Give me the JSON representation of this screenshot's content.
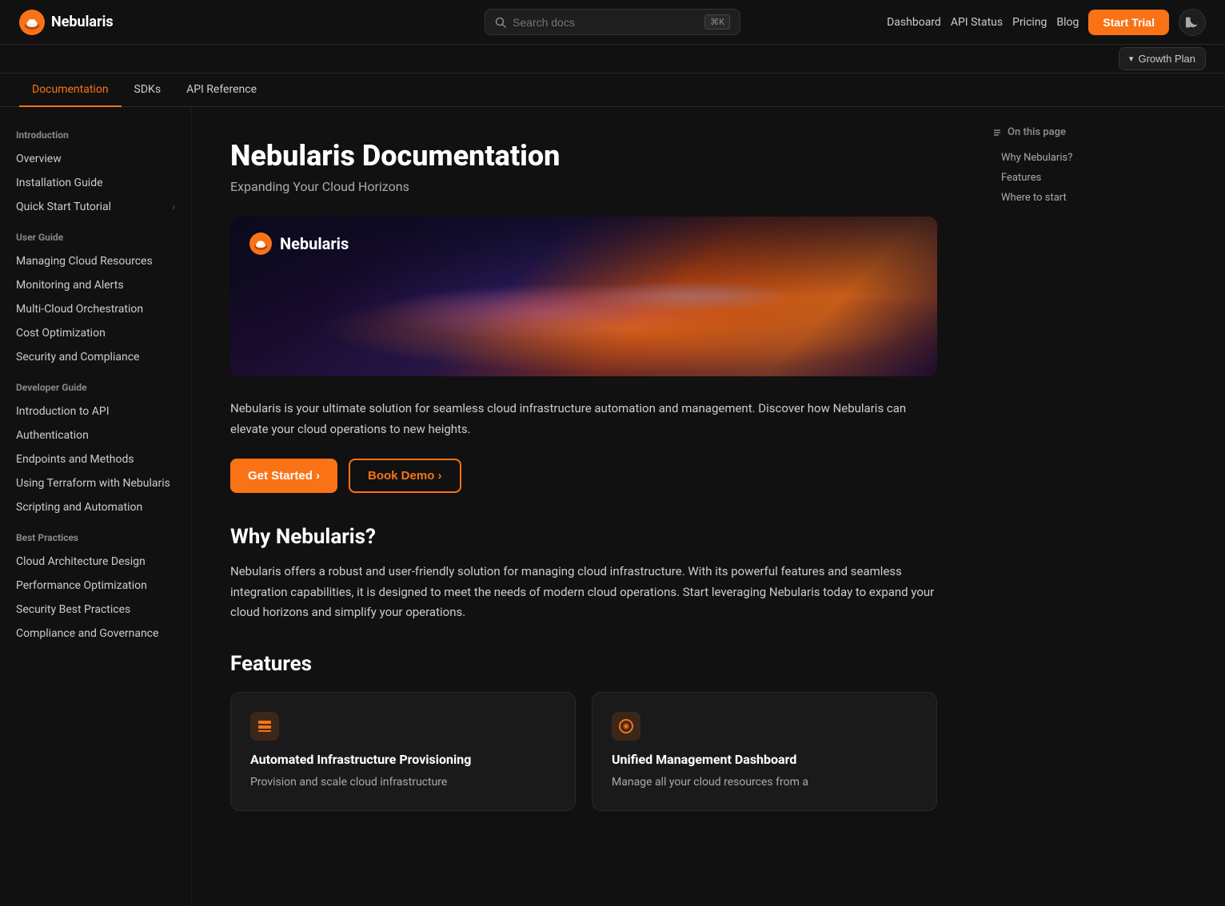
{
  "brand": {
    "name": "Nebularis",
    "logo_alt": "Nebularis logo"
  },
  "topbar": {
    "search_placeholder": "Search docs",
    "search_kbd": "⌘K",
    "nav_links": [
      {
        "label": "Dashboard"
      },
      {
        "label": "API Status"
      },
      {
        "label": "Pricing"
      },
      {
        "label": "Blog"
      }
    ],
    "trial_button": "Start Trial",
    "growth_plan_label": "Growth Plan"
  },
  "subnav": {
    "tabs": [
      {
        "label": "Documentation",
        "active": true
      },
      {
        "label": "SDKs",
        "active": false
      },
      {
        "label": "API Reference",
        "active": false
      }
    ]
  },
  "sidebar": {
    "sections": [
      {
        "title": "Introduction",
        "links": [
          {
            "label": "Overview",
            "chevron": false
          },
          {
            "label": "Installation Guide",
            "chevron": false
          },
          {
            "label": "Quick Start Tutorial",
            "chevron": true
          }
        ]
      },
      {
        "title": "User Guide",
        "links": [
          {
            "label": "Managing Cloud Resources",
            "chevron": false
          },
          {
            "label": "Monitoring and Alerts",
            "chevron": false
          },
          {
            "label": "Multi-Cloud Orchestration",
            "chevron": false
          },
          {
            "label": "Cost Optimization",
            "chevron": false
          },
          {
            "label": "Security and Compliance",
            "chevron": false
          }
        ]
      },
      {
        "title": "Developer Guide",
        "links": [
          {
            "label": "Introduction to API",
            "chevron": false
          },
          {
            "label": "Authentication",
            "chevron": false
          },
          {
            "label": "Endpoints and Methods",
            "chevron": false
          },
          {
            "label": "Using Terraform with Nebularis",
            "chevron": false
          },
          {
            "label": "Scripting and Automation",
            "chevron": false
          }
        ]
      },
      {
        "title": "Best Practices",
        "links": [
          {
            "label": "Cloud Architecture Design",
            "chevron": false
          },
          {
            "label": "Performance Optimization",
            "chevron": false
          },
          {
            "label": "Security Best Practices",
            "chevron": false
          },
          {
            "label": "Compliance and Governance",
            "chevron": false
          }
        ]
      }
    ]
  },
  "main": {
    "title": "Nebularis Documentation",
    "subtitle": "Expanding Your Cloud Horizons",
    "hero_brand": "Nebularis",
    "intro_text": "Nebularis is your ultimate solution for seamless cloud infrastructure automation and management. Discover how Nebularis can elevate your cloud operations to new heights.",
    "cta_primary": "Get Started ›",
    "cta_secondary": "Book Demo ›",
    "why_title": "Why Nebularis?",
    "why_text": "Nebularis offers a robust and user-friendly solution for managing cloud infrastructure. With its powerful features and seamless integration capabilities, it is designed to meet the needs of modern cloud operations. Start leveraging Nebularis today to expand your cloud horizons and simplify your operations.",
    "features_title": "Features",
    "features": [
      {
        "title": "Automated Infrastructure Provisioning",
        "desc": "Provision and scale cloud infrastructure",
        "icon": "☰"
      },
      {
        "title": "Unified Management Dashboard",
        "desc": "Manage all your cloud resources from a",
        "icon": "◎"
      }
    ]
  },
  "right_sidebar": {
    "title": "On this page",
    "links": [
      {
        "label": "Why Nebularis?"
      },
      {
        "label": "Features"
      },
      {
        "label": "Where to start"
      }
    ]
  }
}
